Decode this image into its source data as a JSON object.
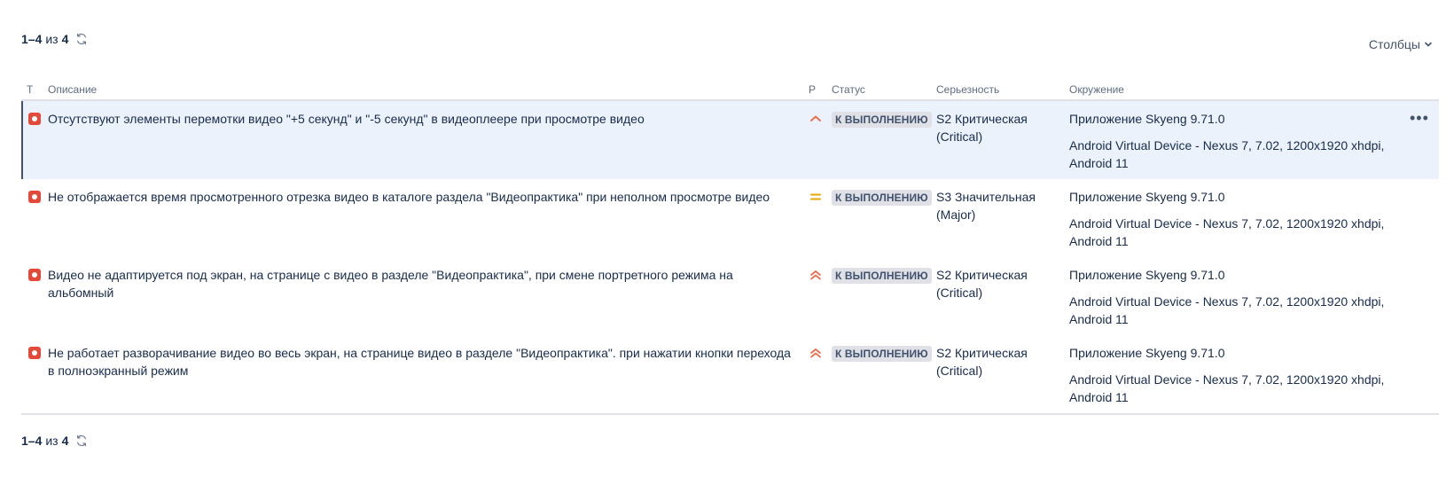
{
  "pager_top": {
    "range": "1–4",
    "of": "из",
    "total": "4",
    "refresh_icon": "refresh-icon"
  },
  "pager_bottom": {
    "range": "1–4",
    "of": "из",
    "total": "4",
    "refresh_icon": "refresh-icon"
  },
  "columns_button": {
    "label": "Столбцы",
    "icon": "chevron-down-icon"
  },
  "headers": {
    "type": "Т",
    "description": "Описание",
    "priority": "P",
    "status": "Статус",
    "severity": "Серьезность",
    "environment": "Окружение"
  },
  "colors": {
    "bug": "#e5493a",
    "priority_high": "#e86f50",
    "priority_medium": "#e6a700",
    "selected_row": "#ebf2fc"
  },
  "rows": [
    {
      "type_icon": "bug-icon",
      "description": "Отсутствуют элементы перемотки видео \"+5 секунд\" и \"-5 секунд\" в видеоплеере при просмотре видео",
      "priority_icon": "priority-high-icon",
      "status": "К ВЫПОЛНЕНИЮ",
      "severity": "S2 Критическая (Critical)",
      "env_app": "Приложение Skyeng 9.71.0",
      "env_device": "Android Virtual Device - Nexus 7, 7.02, 1200x1920 xhdpi, Android 11",
      "selected": true
    },
    {
      "type_icon": "bug-icon",
      "description": "Не отображается время просмотренного отрезка видео в каталоге раздела \"Видеопрактика\" при неполном просмотре видео",
      "priority_icon": "priority-medium-icon",
      "status": "К ВЫПОЛНЕНИЮ",
      "severity": "S3 Значительная (Major)",
      "env_app": "Приложение Skyeng 9.71.0",
      "env_device": "Android Virtual Device - Nexus 7, 7.02, 1200x1920 xhdpi, Android 11"
    },
    {
      "type_icon": "bug-icon",
      "description": "Видео не адаптируется под экран, на странице с видео в разделе \"Видеопрактика\", при смене портретного режима на альбомный",
      "priority_icon": "priority-highest-icon",
      "status": "К ВЫПОЛНЕНИЮ",
      "severity": "S2 Критическая (Critical)",
      "env_app": "Приложение Skyeng 9.71.0",
      "env_device": "Android Virtual Device - Nexus 7, 7.02, 1200x1920 xhdpi, Android 11"
    },
    {
      "type_icon": "bug-icon",
      "description": "Не работает разворачивание видео во весь экран, на странице видео в разделе \"Видеопрактика\". при нажатии кнопки перехода в полноэкранный режим",
      "priority_icon": "priority-highest-icon",
      "status": "К ВЫПОЛНЕНИЮ",
      "severity": "S2 Критическая (Critical)",
      "env_app": "Приложение Skyeng 9.71.0",
      "env_device": "Android Virtual Device - Nexus 7, 7.02, 1200x1920 xhdpi, Android 11"
    }
  ],
  "row_actions_icon": "more-horizontal-icon"
}
